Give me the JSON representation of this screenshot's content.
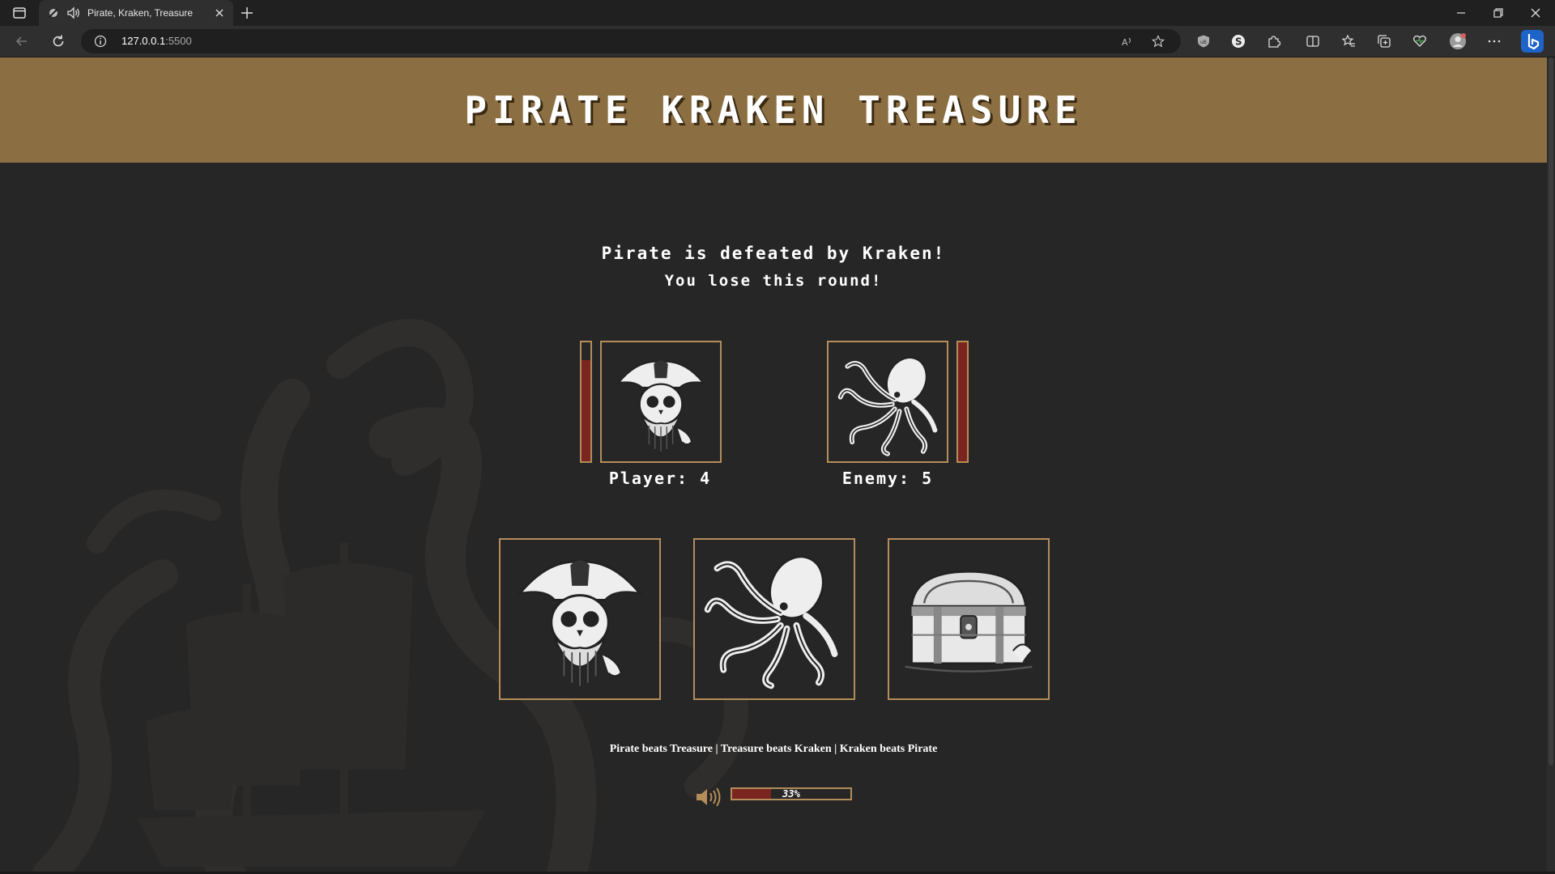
{
  "browser": {
    "tab_title": "Pirate, Kraken, Treasure",
    "url_host": "127.0.0.1",
    "url_port": ":5500"
  },
  "game": {
    "title": "PIRATE KRAKEN TREASURE",
    "result_line1": "Pirate is defeated by Kraken!",
    "result_line2": "You lose this round!",
    "player": {
      "label": "Player: 4",
      "choice": "pirate",
      "health_fraction": 0.85
    },
    "enemy": {
      "label": "Enemy: 5",
      "choice": "kraken",
      "health_fraction": 1.0
    },
    "choices": [
      {
        "name": "pirate",
        "icon": "pirate-skull-icon"
      },
      {
        "name": "kraken",
        "icon": "kraken-octopus-icon"
      },
      {
        "name": "treasure",
        "icon": "treasure-chest-icon"
      }
    ],
    "rules": "Pirate beats Treasure | Treasure beats Kraken | Kraken beats Pirate",
    "volume": {
      "percent_label": "33%",
      "fraction": 0.33
    }
  },
  "colors": {
    "header": "#8b6e42",
    "background": "#262626",
    "border_gold": "#b38d5a",
    "fill_red": "#7a2520"
  }
}
